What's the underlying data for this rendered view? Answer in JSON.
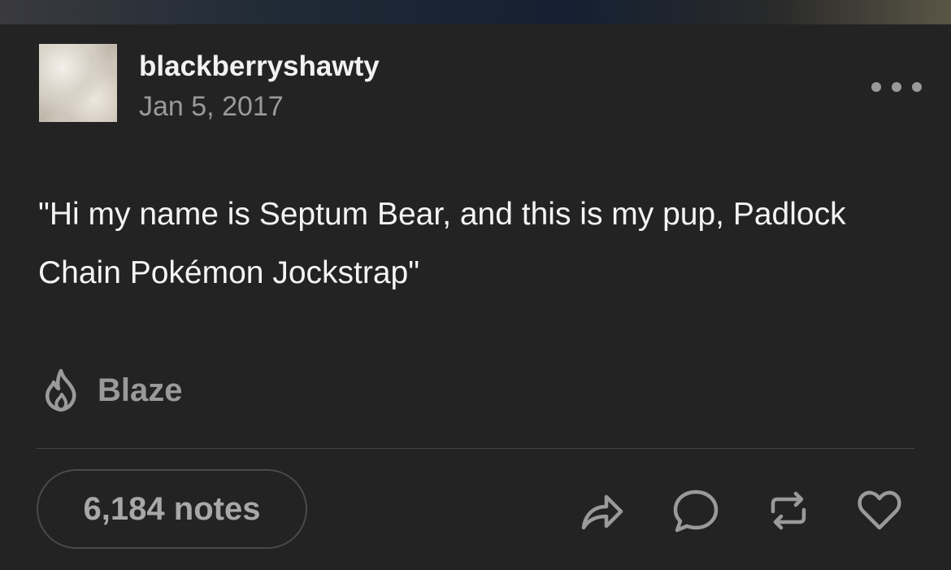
{
  "post": {
    "username": "blackberryshawty",
    "date": "Jan 5, 2017",
    "body": "\"Hi my name is Septum Bear, and this is my pup, Padlock Chain Pokémon Jockstrap\"",
    "blaze_label": "Blaze",
    "notes_label": "6,184 notes"
  },
  "icons": {
    "more": "more-options-icon",
    "blaze": "flame-icon",
    "share": "share-arrow-icon",
    "reply": "comment-bubble-icon",
    "reblog": "reblog-icon",
    "like": "heart-icon"
  },
  "colors": {
    "background": "#232323",
    "primary_text": "#f2f2f2",
    "secondary_text": "#9a9a9a"
  }
}
